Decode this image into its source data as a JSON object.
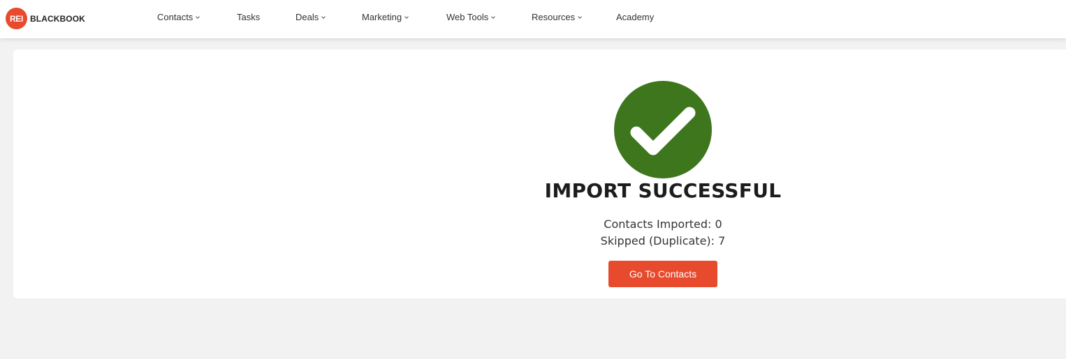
{
  "brand": {
    "badge": "REI",
    "name": "BLACKBOOK",
    "accent_color": "#e84a2e"
  },
  "nav": {
    "items": [
      {
        "label": "Contacts",
        "has_dropdown": true
      },
      {
        "label": "Tasks",
        "has_dropdown": false
      },
      {
        "label": "Deals",
        "has_dropdown": true
      },
      {
        "label": "Marketing",
        "has_dropdown": true
      },
      {
        "label": "Web Tools",
        "has_dropdown": true
      },
      {
        "label": "Resources",
        "has_dropdown": true
      },
      {
        "label": "Academy",
        "has_dropdown": false
      }
    ]
  },
  "result": {
    "icon": "check-circle-icon",
    "icon_color": "#3e761e",
    "title": "IMPORT SUCCESSFUL",
    "contacts_imported": "Contacts Imported: 0",
    "skipped_duplicate": "Skipped (Duplicate): 7",
    "button_label": "Go To Contacts"
  }
}
